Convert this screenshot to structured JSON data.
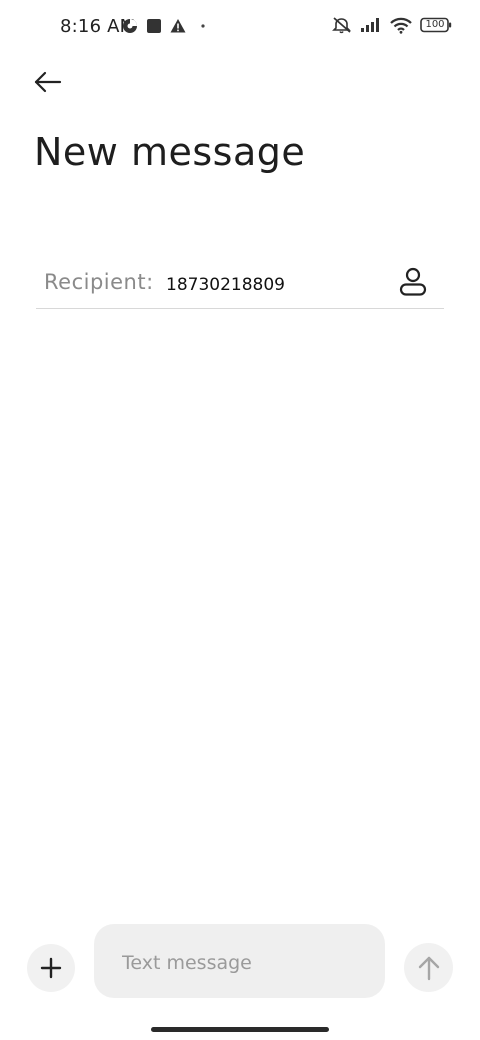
{
  "status_bar": {
    "time": "8:16 AM",
    "battery": "100",
    "icons": [
      "data-saver-icon",
      "square-notification-icon",
      "warning-icon",
      "dot-icon",
      "mute-vibrate-icon",
      "signal-icon",
      "wifi-icon",
      "battery-icon"
    ]
  },
  "header": {
    "back_icon": "back-arrow-icon",
    "title": "New message"
  },
  "recipient": {
    "label": "Recipient:",
    "value": "18730218809",
    "contact_icon": "contact-person-icon"
  },
  "composer": {
    "attach_icon": "plus-icon",
    "placeholder": "Text message",
    "value": "",
    "send_icon": "send-arrow-up-icon"
  },
  "colors": {
    "background": "#ffffff",
    "input_background": "#efefef",
    "button_background": "#f1f1f1",
    "label_gray": "#8a8a8a",
    "divider": "#d8d8d8"
  }
}
